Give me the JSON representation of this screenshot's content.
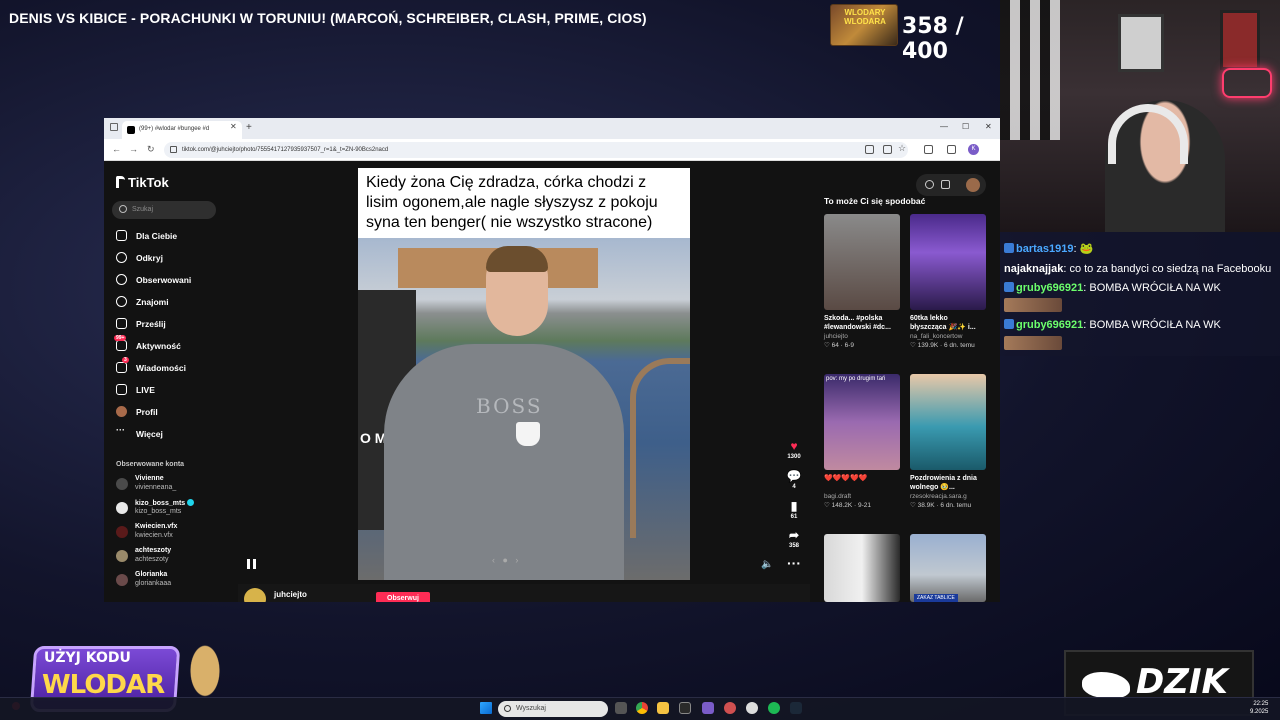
{
  "stream": {
    "title": "DENIS VS KIBICE - PORACHUNKI W TORUNIU! (MARCOŃ, SCHREIBER, CLASH, PRIME, CIOS)",
    "goal_label": "WLODARY WLODARA",
    "goal_progress": "358 / 400",
    "promo_line1": "UŻYJ KODU",
    "promo_line2": "WLODAR",
    "sponsor": "DZIK"
  },
  "chat": {
    "messages": [
      {
        "user": "bartas1919",
        "text": ": 🐸",
        "user_color": "#4aa8ff"
      },
      {
        "user": "najaknajjak",
        "text": ": co to za bandyci co siedzą na Facebooku",
        "user_color": "#ffffff"
      },
      {
        "user": "gruby696921",
        "text": ": BOMBA WRÓCIŁA NA WK",
        "user_color": "#6cff6c"
      },
      {
        "user": "gruby696921",
        "text": ": BOMBA WRÓCIŁA NA WK",
        "user_color": "#6cff6c"
      }
    ]
  },
  "browser": {
    "tab_title": "(99+) #wlodar #bungee #d",
    "url": "tiktok.com/@juhciejto/photo/7555417127935937507_r=1&_t=ZN-90Bcs2nacd",
    "avatar_letter": "K"
  },
  "tiktok": {
    "logo": "TikTok",
    "search_placeholder": "Szukaj",
    "nav": [
      {
        "label": "Dla Ciebie",
        "icon": "home-icon"
      },
      {
        "label": "Odkryj",
        "icon": "compass-icon"
      },
      {
        "label": "Obserwowani",
        "icon": "following-icon"
      },
      {
        "label": "Znajomi",
        "icon": "friends-icon"
      },
      {
        "label": "Prześlij",
        "icon": "upload-icon"
      },
      {
        "label": "Aktywność",
        "icon": "activity-icon",
        "badge": "99+"
      },
      {
        "label": "Wiadomości",
        "icon": "messages-icon",
        "badge": "3"
      },
      {
        "label": "LIVE",
        "icon": "live-icon"
      },
      {
        "label": "Profil",
        "icon": "profile-icon"
      },
      {
        "label": "Więcej",
        "icon": "more-icon"
      }
    ],
    "followed_title": "Obserwowane konta",
    "followed": [
      {
        "name": "Vivienne",
        "handle": "vivienneana_"
      },
      {
        "name": "kizo_boss_mts",
        "handle": "kizo_boss_mts",
        "verified": true
      },
      {
        "name": "Kwiecien.vfx",
        "handle": "kwiecien.vfx"
      },
      {
        "name": "achteszoty",
        "handle": "achteszoty"
      },
      {
        "name": "Glorianka",
        "handle": "gloriankaaa"
      }
    ],
    "video": {
      "caption": "Kiedy żona Cię zdradza, córka chodzi z lisim ogonem,ale nagle słyszysz z pokoju syna ten  benger( nie wszystko stracone)",
      "shirt_text": "BOSS",
      "poster_text": "O MIE"
    },
    "actions": {
      "likes": "1300",
      "comments": "4",
      "saves": "61",
      "shares": "358"
    },
    "author": "juhciejto",
    "follow_label": "Obserwuj",
    "recs_title": "To może Ci się spodobać",
    "recs": [
      {
        "title": "Szkoda... #polska #lewandowski #dc...",
        "author": "juhciejto",
        "meta": "♡ 64 · 6-9",
        "color": "#6a5f58"
      },
      {
        "title": "60tka lekko błyszcząca 🎉✨ i...",
        "author": "na_fali_koncertow",
        "meta": "♡ 139.9K · 6 dn. temu",
        "color": "#5a3a9a"
      },
      {
        "title": "❤️❤️❤️❤️❤️",
        "author": "bagi.draft",
        "meta": "♡ 148.2K · 9-21",
        "color": "#7a5aa0",
        "overlay": "pov: my po drugim tań"
      },
      {
        "title": "Pozdrowienia z dnia wolnego 🥹...",
        "author": "rzesokreacja.sara.g",
        "meta": "♡ 38.9K · 6 dn. temu",
        "color": "#2f8aa0"
      },
      {
        "title": "",
        "author": "",
        "meta": "",
        "color": "#c9c9c9"
      },
      {
        "title": "",
        "author": "",
        "meta": "",
        "color": "#8aa0c0",
        "tag": "ZAKAZ TABLICE"
      }
    ]
  },
  "taskbar": {
    "search_placeholder": "Wyszukaj",
    "time": "22:25",
    "date": "9.2025"
  }
}
